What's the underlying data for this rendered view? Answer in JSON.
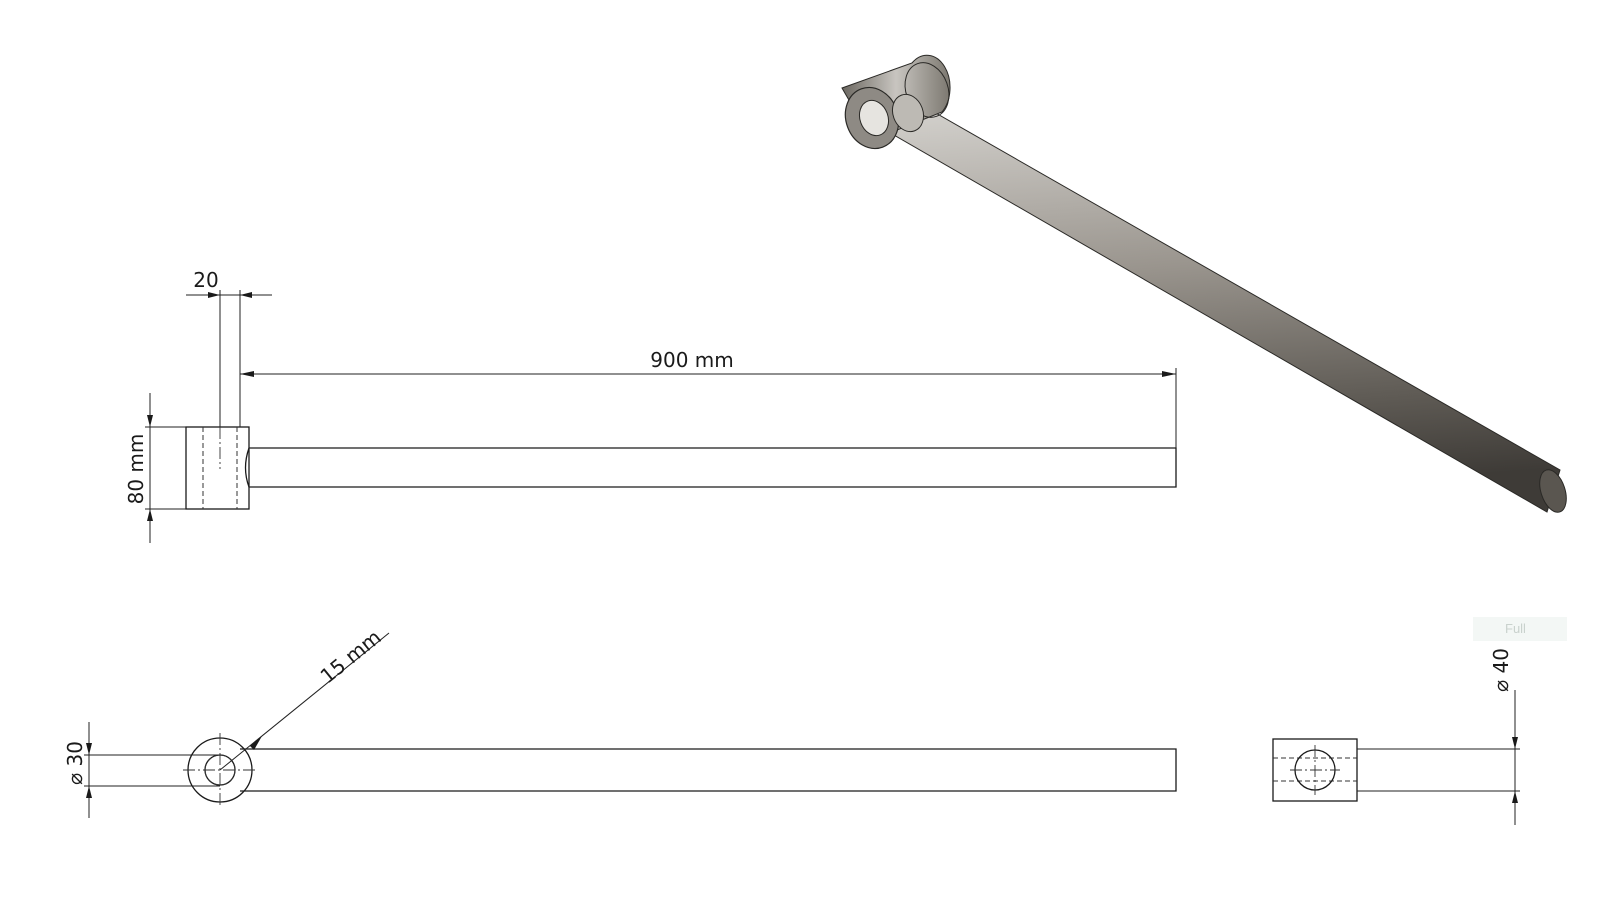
{
  "dimensions": {
    "length": "900 mm",
    "boss_width": "20",
    "boss_height": "80 mm",
    "hole_radius": "15 mm",
    "boss_diameter": "⌀ 30",
    "rod_diameter": "⌀ 40"
  },
  "badge": {
    "label": "Full"
  }
}
